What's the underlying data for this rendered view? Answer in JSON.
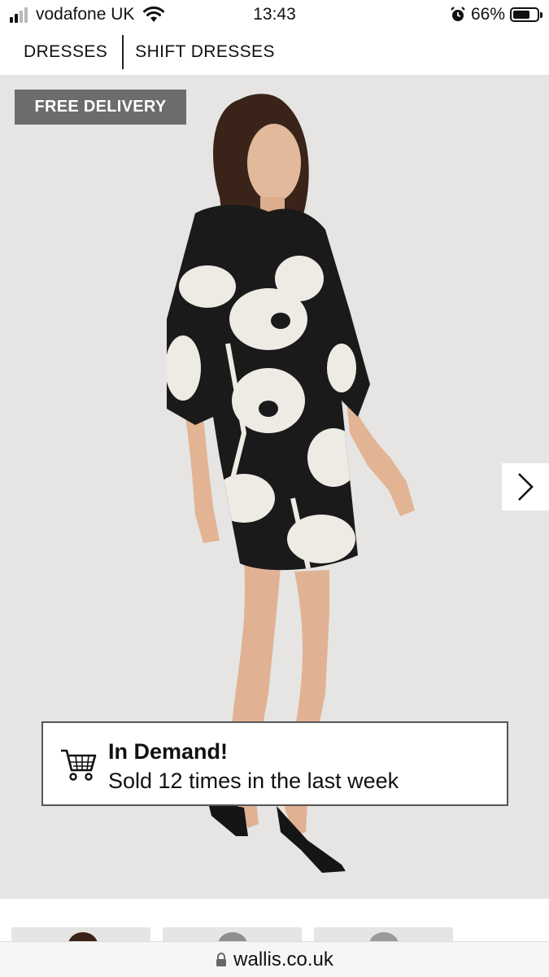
{
  "status_bar": {
    "carrier": "vodafone UK",
    "time": "13:43",
    "battery": "66%",
    "signal_bars": 4,
    "signal_active": 2
  },
  "breadcrumb": {
    "items": [
      "DRESSES",
      "SHIFT DRESSES"
    ]
  },
  "product": {
    "badge": "FREE DELIVERY",
    "next_icon": "chevron-right-icon",
    "dress_colors": {
      "black": "#1a1a1a",
      "cream": "#eeebe4"
    }
  },
  "demand_popup": {
    "icon": "cart-icon",
    "title": "In Demand!",
    "subtitle": "Sold 12 times in the last week"
  },
  "browser": {
    "url": "wallis.co.uk",
    "icon": "lock-icon"
  },
  "colors": {
    "badge_bg": "#6c6c6c",
    "hero_bg": "#e6e5e3"
  }
}
